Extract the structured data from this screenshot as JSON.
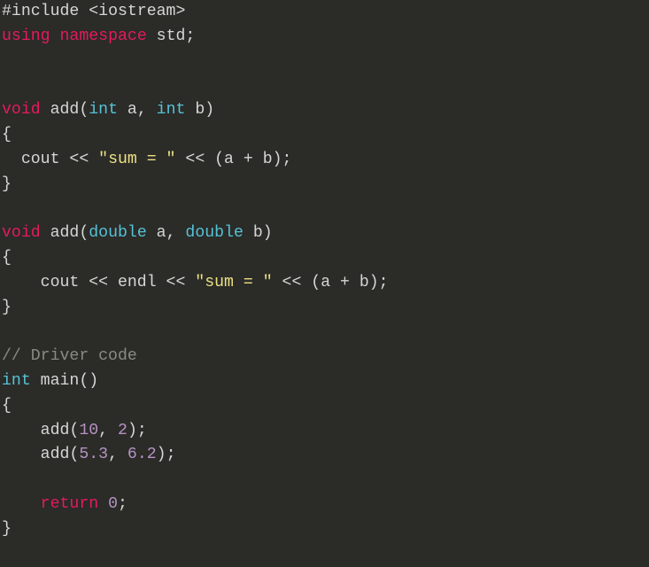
{
  "code": {
    "include_hash": "#include",
    "include_hdr": " <iostream>",
    "using": "using",
    "namespace": "namespace",
    "std": " std;",
    "void1": "void",
    "add1": " add(",
    "int_a": "int",
    "a1": " a, ",
    "int_b": "int",
    "b1": " b)",
    "brace_o1": "{",
    "l1_indent": "  cout << ",
    "l1_str": "\"sum = \"",
    "l1_tail": " << (a + b);",
    "brace_c1": "}",
    "void2": "void",
    "add2": " add(",
    "dbl_a": "double",
    "a2": " a, ",
    "dbl_b": "double",
    "b2": " b)",
    "brace_o2": "{",
    "l2_indent": "    cout << endl << ",
    "l2_str": "\"sum = \"",
    "l2_tail": " << (a + b);",
    "brace_c2": "}",
    "comment": "// Driver code",
    "int_main": "int",
    "main": " main()",
    "brace_o3": "{",
    "call1_indent": "    add(",
    "call1_n1": "10",
    "call1_sep": ", ",
    "call1_n2": "2",
    "call1_end": ");",
    "call2_indent": "    add(",
    "call2_n1": "5.3",
    "call2_sep": ", ",
    "call2_n2": "6.2",
    "call2_end": ");",
    "ret_indent": "    ",
    "return": "return",
    "ret_sp": " ",
    "ret_zero": "0",
    "ret_semi": ";",
    "brace_c3": "}"
  }
}
